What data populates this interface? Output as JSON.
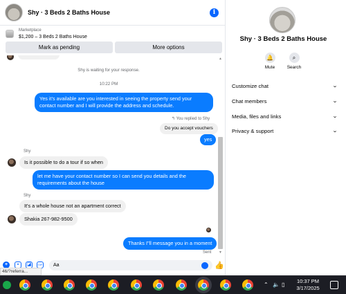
{
  "header": {
    "title": "Shy · 3 Beds 2 Baths House"
  },
  "listing": {
    "label": "Marketplace",
    "summary": "$1,200 – 3 Beds 2 Baths House"
  },
  "actions": {
    "mark_pending": "Mark as pending",
    "more_options": "More options"
  },
  "messages": {
    "waiting_notice": "Shy is waiting for your response.",
    "timestamp": "10:22 PM",
    "m1": "Yes it's available are you interested in seeing the property send your contact number and I will provide the address and schedule.",
    "reply_notice": "You replied to Shy",
    "quoted": "Do you accept vouchers",
    "m2": "yes",
    "sender1": "Shy",
    "m3": "Is it possible to do a tour if so when",
    "m4": "let me have your contact number so I can send you details and the requirements about the house",
    "sender2": "Shy",
    "m5": "It's a whole house not an apartment correct",
    "m6": "Shakia 267-982-9500",
    "m7": "Thanks I\"ll message you in a moment",
    "status": "Sent"
  },
  "composer": {
    "input_value": "Aa",
    "url_hint": "46/?referra..."
  },
  "panel": {
    "title": "Shy · 3 Beds 2 Baths House",
    "mute_label": "Mute",
    "search_label": "Search",
    "menu": [
      "Customize chat",
      "Chat members",
      "Media, files and links",
      "Privacy & support"
    ]
  },
  "taskbar": {
    "time": "10:37 PM",
    "date": "3/17/2025"
  },
  "colors": {
    "accent": "#0866ff",
    "outgoing_bubble": "#0a7cff",
    "incoming_bubble": "#f0f0f0",
    "taskbar": "#1c1d24"
  }
}
